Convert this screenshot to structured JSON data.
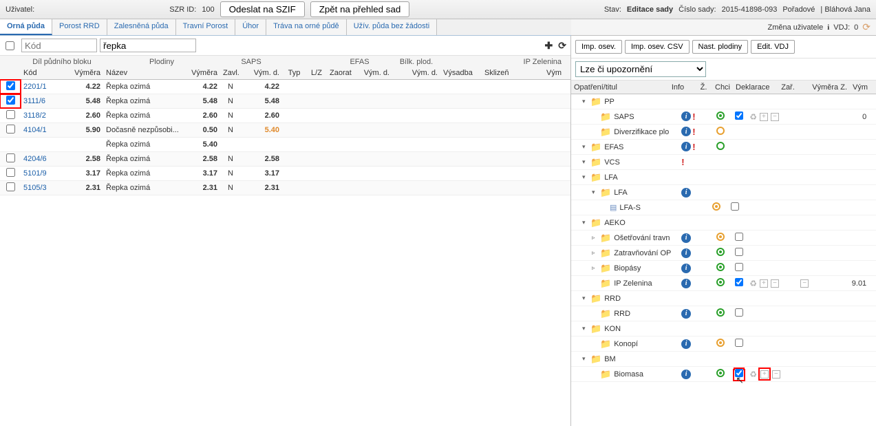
{
  "topbar": {
    "user_label": "Uživatel:",
    "szr_label": "SZR ID:",
    "szr_value": "100",
    "btn_send": "Odeslat na SZIF",
    "btn_back": "Zpět na přehled sad",
    "stav_label": "Stav:",
    "stav_value": "Editace sady",
    "cislo_label": "Číslo sady:",
    "cislo_value": "2015-41898-093",
    "poradove_label": "Pořadové",
    "user_name": "| Bláhová Jana"
  },
  "tabs": [
    "Orná půda",
    "Porost RRD",
    "Zalesněná půda",
    "Travní Porost",
    "Úhor",
    "Tráva na orné půdě",
    "Užív. půda bez žádosti"
  ],
  "rtab": {
    "change_user": "Změna uživatele",
    "vdj_label": "VDJ:",
    "vdj_value": "0"
  },
  "filter": {
    "kod_placeholder": "Kód",
    "plod_value": "řepka"
  },
  "thead": {
    "group_dil": "Díl půdního bloku",
    "group_plodiny": "Plodiny",
    "group_saps": "SAPS",
    "group_efas": "EFAS",
    "group_bilk": "Bílk. plod.",
    "group_ipz": "IP Zelenina",
    "kod": "Kód",
    "vym": "Výměra",
    "nazev": "Název",
    "vymp": "Výměra",
    "zavl": "Zavl.",
    "saps_vymd": "Vým. d.",
    "typ": "Typ",
    "lz": "L/Z",
    "zaorat": "Zaorat",
    "efas_vymd": "Vým. d.",
    "bilk_vymd": "Vým. d.",
    "vysadba": "Výsadba",
    "sklizen": "Sklizeň",
    "ipz_vym": "Vým"
  },
  "rows": [
    {
      "chk": true,
      "hl": true,
      "kod": "2201/1",
      "vym": "4.22",
      "nazev": "Řepka ozimá",
      "vymp": "4.22",
      "zavl": "N",
      "saps": "4.22"
    },
    {
      "chk": true,
      "hl": true,
      "kod": "3111/6",
      "vym": "5.48",
      "nazev": "Řepka ozimá",
      "vymp": "5.48",
      "zavl": "N",
      "saps": "5.48"
    },
    {
      "chk": false,
      "kod": "3118/2",
      "vym": "2.60",
      "nazev": "Řepka ozimá",
      "vymp": "2.60",
      "zavl": "N",
      "saps": "2.60"
    },
    {
      "chk": false,
      "kod": "4104/1",
      "vym": "5.90",
      "nazev": "Dočasně nezpůsobi...",
      "vymp": "0.50",
      "zavl": "N",
      "saps": "5.40",
      "saps_orange": true,
      "extra_nazev": "Řepka ozimá",
      "extra_vymp": "5.40"
    },
    {
      "chk": false,
      "kod": "4204/6",
      "vym": "2.58",
      "nazev": "Řepka ozimá",
      "vymp": "2.58",
      "zavl": "N",
      "saps": "2.58"
    },
    {
      "chk": false,
      "kod": "5101/9",
      "vym": "3.17",
      "nazev": "Řepka ozimá",
      "vymp": "3.17",
      "zavl": "N",
      "saps": "3.17"
    },
    {
      "chk": false,
      "kod": "5105/3",
      "vym": "2.31",
      "nazev": "Řepka ozimá",
      "vymp": "2.31",
      "zavl": "N",
      "saps": "2.31"
    }
  ],
  "rtoolbar": {
    "b1": "Imp. osev.",
    "b2": "Imp. osev. CSV",
    "b3": "Nast. plodiny",
    "b4": "Edit. VDJ"
  },
  "select_label": "Lze či upozornění",
  "treehead": {
    "op": "Opatření/titul",
    "info": "Info",
    "z": "Ž.",
    "chci": "Chci",
    "dek": "Deklarace",
    "zar": "Zař.",
    "vymz": "Výměra Z.",
    "vymn": "Vým"
  },
  "tree": [
    {
      "lvl": 1,
      "exp": "▾",
      "icon": "folder",
      "label": "PP"
    },
    {
      "lvl": 2,
      "icon": "folder",
      "label": "SAPS",
      "info": true,
      "excl": true,
      "z": "green-dot",
      "chci": "checked",
      "dek_icons": true,
      "vymz": "0"
    },
    {
      "lvl": 2,
      "icon": "folder",
      "label": "Diverzifikace plo",
      "info": true,
      "excl": true,
      "z": "orange"
    },
    {
      "lvl": 1,
      "exp": "▾",
      "icon": "folder",
      "label": "EFAS",
      "info": true,
      "excl": true,
      "z": "green"
    },
    {
      "lvl": 1,
      "exp": "▾",
      "icon": "folder",
      "label": "VCS",
      "excl": true
    },
    {
      "lvl": 1,
      "exp": "▾",
      "icon": "folder",
      "label": "LFA"
    },
    {
      "lvl": 2,
      "exp": "▾",
      "icon": "folder",
      "label": "LFA",
      "info": true
    },
    {
      "lvl": 3,
      "icon": "doc",
      "label": "LFA-S",
      "z": "orange-dot",
      "chci": "unchecked"
    },
    {
      "lvl": 1,
      "exp": "▾",
      "icon": "folder",
      "label": "AEKO"
    },
    {
      "lvl": 2,
      "exp": "▹",
      "icon": "folder",
      "label": "Ošetřování travn",
      "info": true,
      "z": "orange-dot",
      "chci": "unchecked"
    },
    {
      "lvl": 2,
      "exp": "▹",
      "icon": "folder",
      "label": "Zatravňování OP",
      "info": true,
      "z": "green-dot",
      "chci": "unchecked"
    },
    {
      "lvl": 2,
      "exp": "▹",
      "icon": "folder",
      "label": "Biopásy",
      "info": true,
      "z": "green-dot",
      "chci": "unchecked"
    },
    {
      "lvl": 2,
      "icon": "folder",
      "label": "IP Zelenina",
      "info": true,
      "z": "green-dot",
      "chci": "checked",
      "dek_icons": true,
      "zar_minus": true,
      "vymz": "9.01"
    },
    {
      "lvl": 1,
      "exp": "▾",
      "icon": "folder",
      "label": "RRD"
    },
    {
      "lvl": 2,
      "icon": "folder",
      "label": "RRD",
      "info": true,
      "z": "green-dot",
      "chci": "unchecked"
    },
    {
      "lvl": 1,
      "exp": "▾",
      "icon": "folder",
      "label": "KON"
    },
    {
      "lvl": 2,
      "icon": "folder",
      "label": "Konopí",
      "info": true,
      "z": "orange-dot",
      "chci": "unchecked"
    },
    {
      "lvl": 1,
      "exp": "▾",
      "icon": "folder",
      "label": "BM"
    },
    {
      "lvl": 2,
      "icon": "folder",
      "label": "Biomasa",
      "info": true,
      "z": "green-dot",
      "chci": "checked-hl",
      "dek_icons": true,
      "dek_hl": true
    }
  ]
}
